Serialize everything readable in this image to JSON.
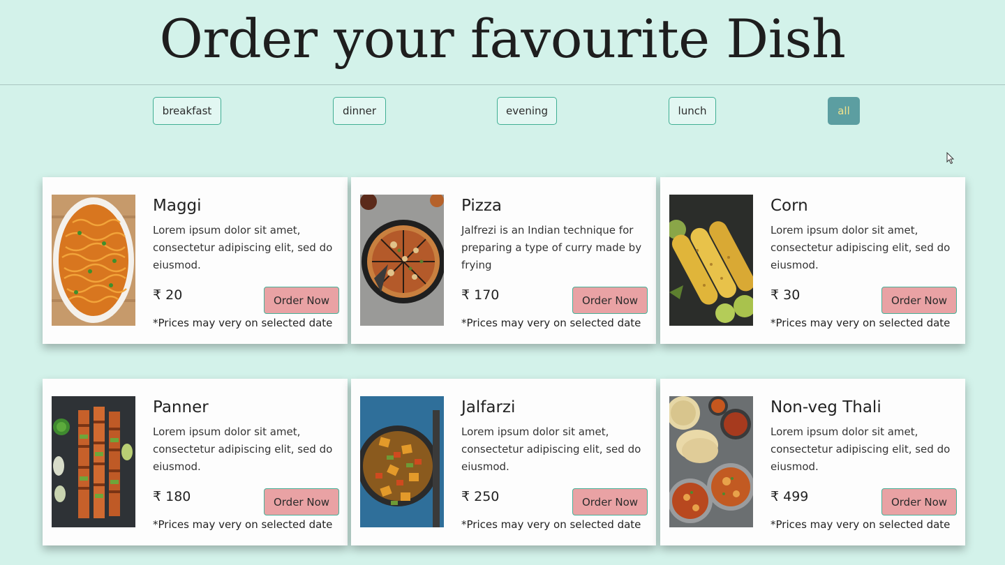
{
  "page_title": "Order your favourite Dish",
  "filters": [
    {
      "label": "breakfast",
      "active": false
    },
    {
      "label": "dinner",
      "active": false
    },
    {
      "label": "evening",
      "active": false
    },
    {
      "label": "lunch",
      "active": false
    },
    {
      "label": "all",
      "active": true
    }
  ],
  "currency": "₹",
  "price_note": "*Prices may very on selected date",
  "order_label": "Order Now",
  "colors": {
    "background": "#d3f2ea",
    "active_filter": "#5c9ea1",
    "order_button": "#e9a2a4",
    "button_border": "#47b198"
  },
  "dishes": [
    {
      "name": "Maggi",
      "desc": "Lorem ipsum dolor sit amet, consectetur adipiscing elit, sed do eiusmod.",
      "price": "₹ 20",
      "icon": "maggi-photo"
    },
    {
      "name": "Pizza",
      "desc": "Jalfrezi is an Indian technique for preparing a type of curry made by frying",
      "price": "₹ 170",
      "icon": "pizza-photo"
    },
    {
      "name": "Corn",
      "desc": "Lorem ipsum dolor sit amet, consectetur adipiscing elit, sed do eiusmod.",
      "price": "₹ 30",
      "icon": "corn-photo"
    },
    {
      "name": "Panner",
      "desc": "Lorem ipsum dolor sit amet, consectetur adipiscing elit, sed do eiusmod.",
      "price": "₹ 180",
      "icon": "panner-photo"
    },
    {
      "name": "Jalfarzi",
      "desc": "Lorem ipsum dolor sit amet, consectetur adipiscing elit, sed do eiusmod.",
      "price": "₹ 250",
      "icon": "jalfarzi-photo"
    },
    {
      "name": "Non-veg Thali",
      "desc": "Lorem ipsum dolor sit amet, consectetur adipiscing elit, sed do eiusmod.",
      "price": "₹ 499",
      "icon": "thali-photo"
    }
  ]
}
